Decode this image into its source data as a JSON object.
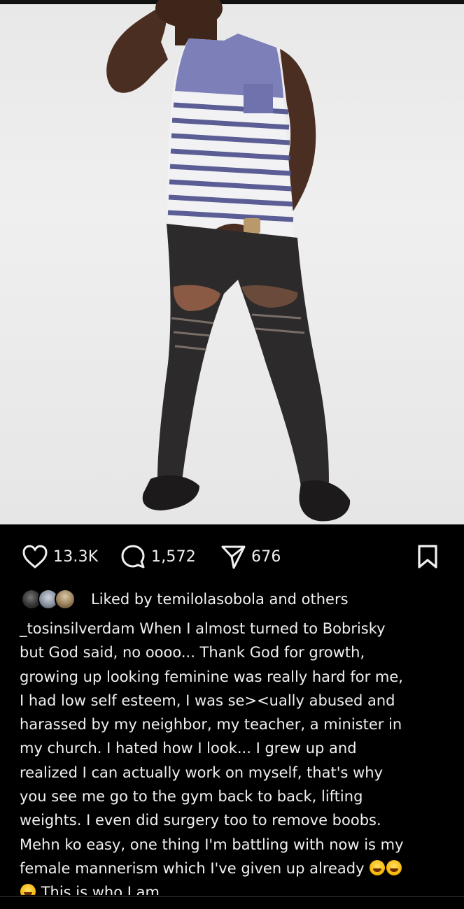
{
  "post": {
    "image_alt": "photo of person in striped tank top and ripped jeans",
    "likes_count": "13.3K",
    "comments_count": "1,572",
    "shares_count": "676",
    "liked_by_text": "Liked by temilolasobola and others",
    "username": "_tosinsilverdam",
    "caption_lines": [
      "When I almost turned to Bobrisky",
      "but God said, no oooo... Thank God for growth,",
      "growing up looking feminine was really hard for me,",
      "I had low self esteem, I was se><ually abused and",
      "harassed by my neighbor, my teacher, a minister in",
      "my church. I hated how I look... I grew up and",
      "realized I can actually work on myself, that's why",
      "you see me go to the gym back to back, lifting",
      "weights. I even did surgery too to remove boobs.",
      "Mehn ko easy, one thing I'm battling with now is my",
      "female mannerism which I've given up already",
      "This is who I am"
    ]
  },
  "icons": {
    "like": "heart-icon",
    "comment": "comment-icon",
    "share": "send-icon",
    "save": "bookmark-icon"
  },
  "colors": {
    "background": "#000000",
    "text": "#f0f0f0"
  }
}
